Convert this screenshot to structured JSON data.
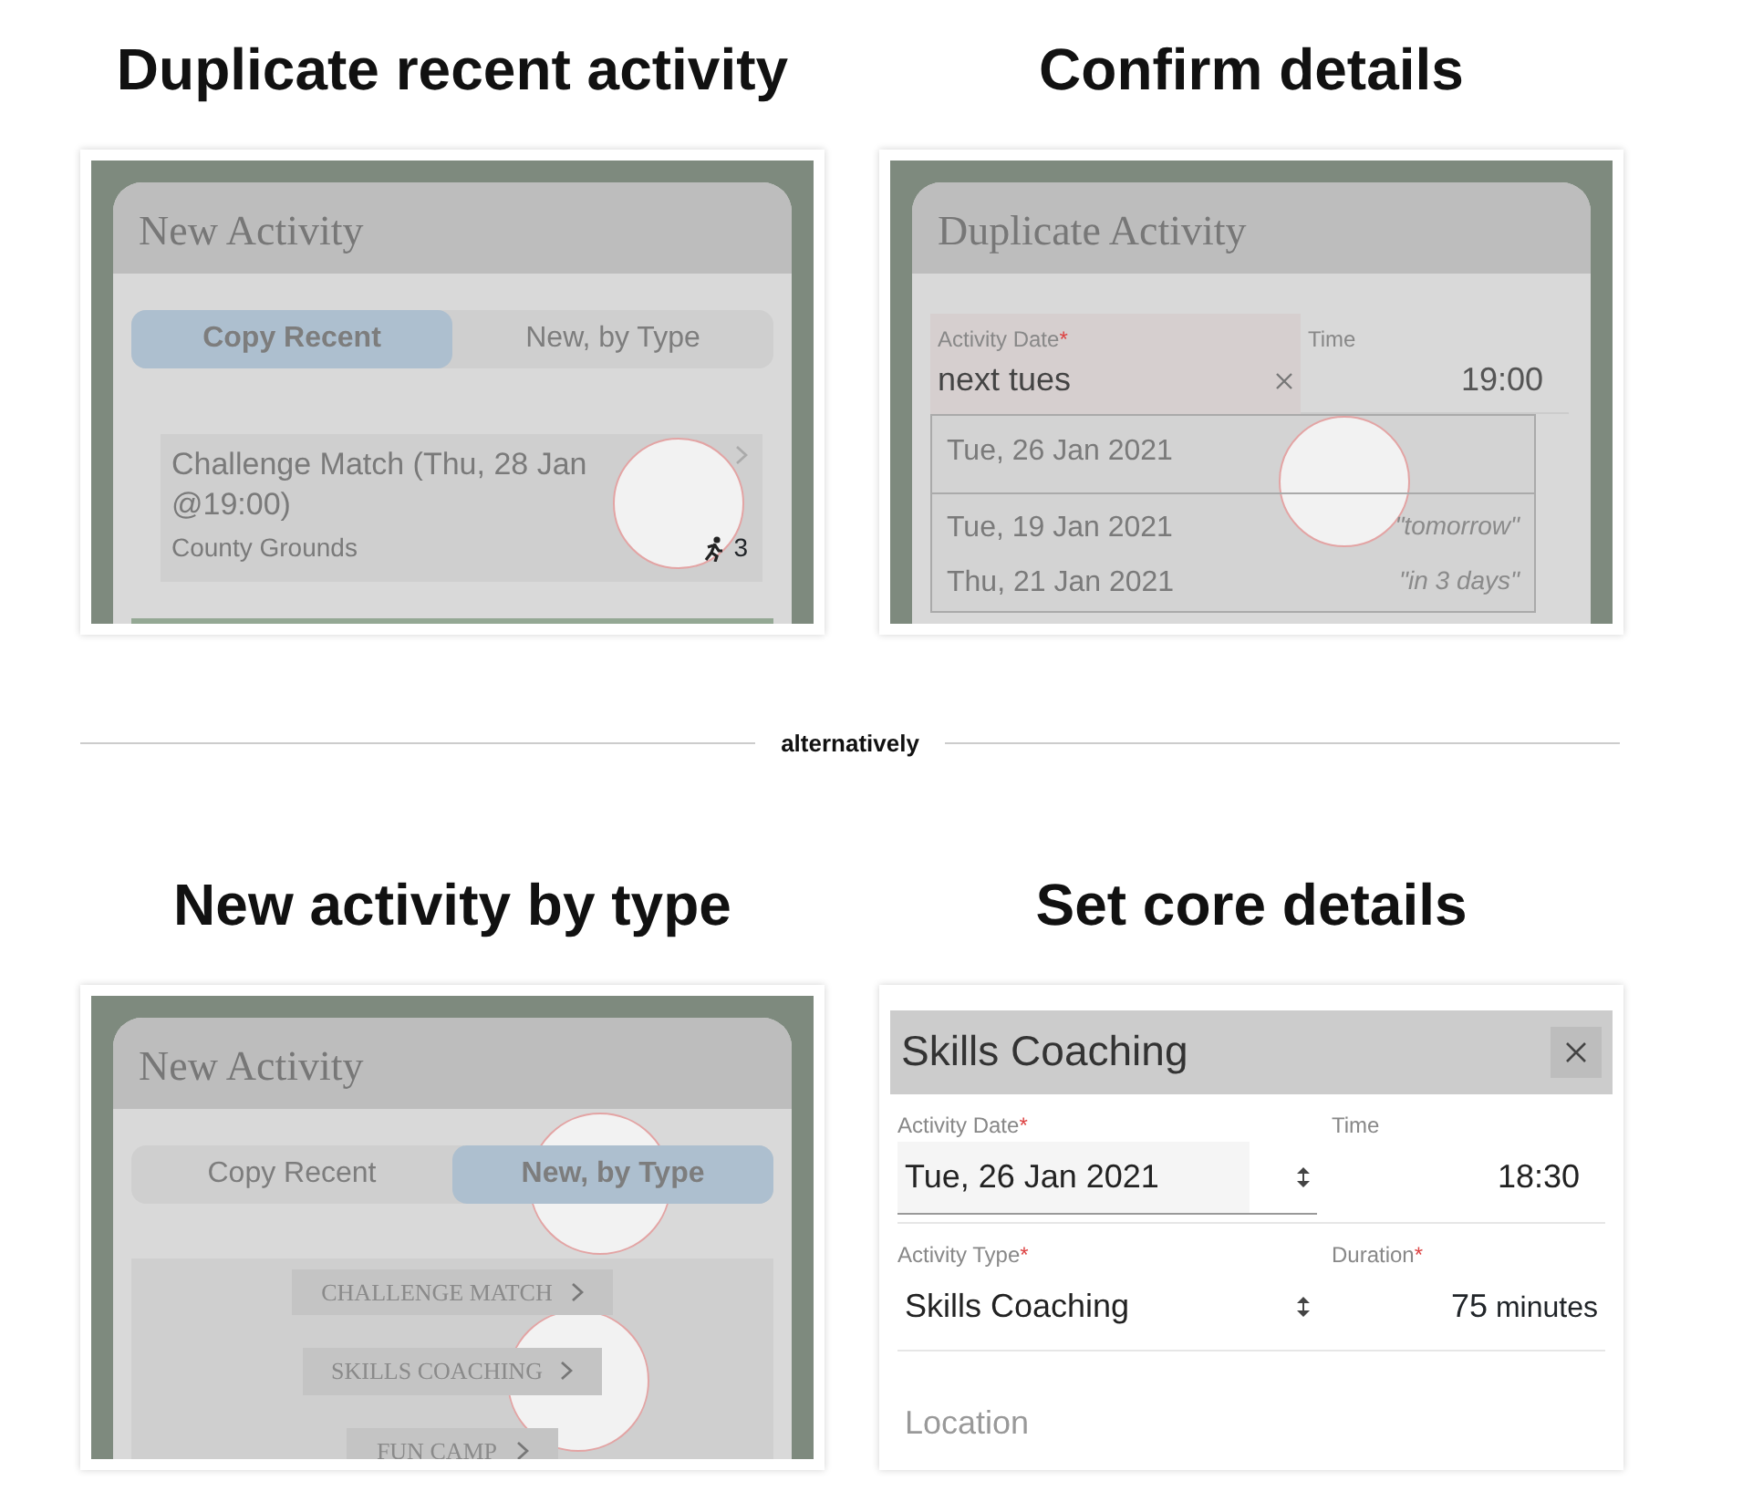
{
  "sections": [
    {
      "heading": "Duplicate recent activity",
      "kind": "chooser",
      "screen": {
        "title": "New Activity",
        "tabs": [
          {
            "label": "Copy Recent",
            "selected": true
          },
          {
            "label": "New, by Type",
            "selected": false
          }
        ],
        "recent": {
          "title": "Challenge Match (Thu, 28 Jan @19:00)",
          "subtitle": "County Grounds",
          "count": "3"
        }
      }
    },
    {
      "heading": "Confirm details",
      "kind": "date_picker",
      "screen": {
        "title": "Duplicate Activity",
        "date_field": {
          "label": "Activity Date",
          "mark": "*",
          "value": "next tues"
        },
        "time_field": {
          "label": "Time",
          "value": "19:00"
        },
        "options": [
          {
            "date": "Tue, 26 Jan 2021",
            "selected": true
          },
          {
            "date": "Tue, 19 Jan 2021",
            "hint": "\"tomorrow\"",
            "selected": false
          },
          {
            "date": "Thu, 21 Jan 2021",
            "hint": "\"in 3 days\"",
            "selected": false
          }
        ]
      }
    },
    {
      "heading": "New activity by type",
      "kind": "chooser",
      "screen": {
        "title": "New Activity",
        "tabs": [
          {
            "label": "Copy Recent",
            "selected": false
          },
          {
            "label": "New, by Type",
            "selected": true
          }
        ],
        "types": [
          "CHALLENGE MATCH",
          "SKILLS COACHING",
          "FUN CAMP"
        ]
      }
    },
    {
      "heading": "Set core details",
      "kind": "form",
      "screen": {
        "title": "Skills Coaching",
        "fields": [
          {
            "label": "Activity Date",
            "mark": "*",
            "value": "Tue, 26 Jan 2021",
            "kind": "select"
          },
          {
            "label": "Time",
            "value": "18:30",
            "kind": "time"
          },
          {
            "label": "Activity Type",
            "mark": "*",
            "value": "Skills Coaching",
            "kind": "select"
          },
          {
            "label": "Duration",
            "mark": "*",
            "value": "75",
            "unit": "minutes",
            "kind": "number"
          }
        ],
        "location": {
          "placeholder": "Location"
        }
      }
    }
  ],
  "divider": {
    "label": "alternatively"
  }
}
